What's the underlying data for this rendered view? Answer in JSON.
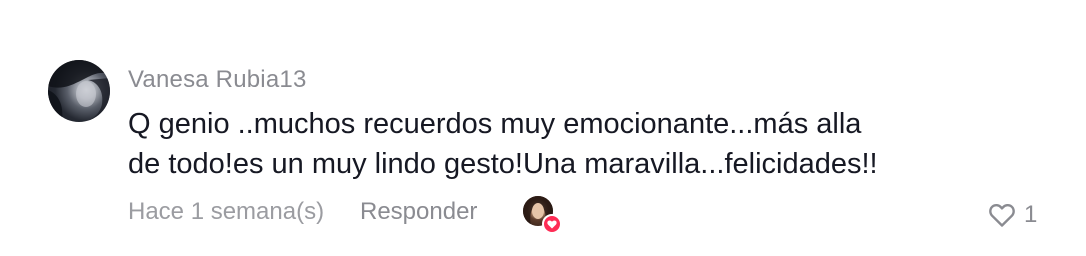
{
  "comment": {
    "username": "Vanesa Rubia13",
    "text_lines": [
      "Q genio ..muchos recuerdos muy emocionante...más alla",
      "de todo!es un muy lindo gesto!Una maravilla...felicidades!!"
    ],
    "timestamp": "Hace 1 semana(s)",
    "reply_label": "Responder",
    "like_count": "1",
    "liked_by_creator": true
  },
  "icons": {
    "like": "heart-outline-icon",
    "creator_like_badge": "heart-badge-icon"
  },
  "colors": {
    "username": "#8a8b91",
    "text": "#161823",
    "meta": "#9b9ca1",
    "badge": "#fe2c55"
  }
}
